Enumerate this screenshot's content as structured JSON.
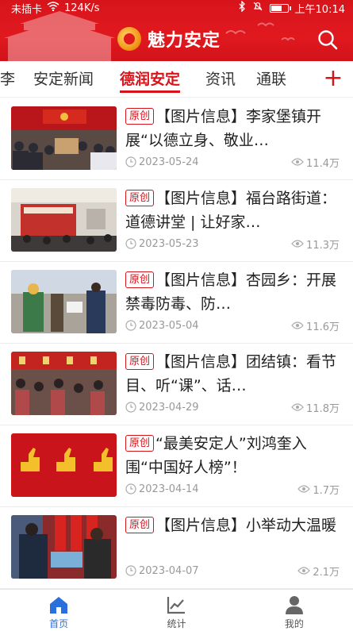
{
  "status_bar": {
    "left_text": "未插卡",
    "speed": "124K/s",
    "time": "上午10:14"
  },
  "header": {
    "title": "魅力安定"
  },
  "tabs": [
    {
      "label": "李",
      "active": false
    },
    {
      "label": "安定新闻",
      "active": false
    },
    {
      "label": "德润安定",
      "active": true
    },
    {
      "label": "资讯",
      "active": false
    },
    {
      "label": "通联",
      "active": false
    }
  ],
  "add_label": "+",
  "articles": [
    {
      "badge": "原创",
      "title": "【图片信息】李家堡镇开展“以德立身、敬业…",
      "date": "2023-05-24",
      "views": "11.4万"
    },
    {
      "badge": "原创",
      "title": "【图片信息】福台路街道：道德讲堂 | 让好家…",
      "date": "2023-05-23",
      "views": "11.3万"
    },
    {
      "badge": "原创",
      "title": "【图片信息】杏园乡：开展禁毒防毒、防…",
      "date": "2023-05-04",
      "views": "11.6万"
    },
    {
      "badge": "原创",
      "title": "【图片信息】团结镇：看节目、听“课”、话…",
      "date": "2023-04-29",
      "views": "11.8万"
    },
    {
      "badge": "原创",
      "title": "“最美安定人”刘鸿奎入围“中国好人榜”！",
      "date": "2023-04-14",
      "views": "1.7万"
    },
    {
      "badge": "原创",
      "title": "【图片信息】小举动大温暖",
      "date": "2023-04-07",
      "views": "2.1万"
    }
  ],
  "bottom_nav": [
    {
      "label": "首页",
      "icon": "home-icon",
      "active": true
    },
    {
      "label": "统计",
      "icon": "chart-icon",
      "active": false
    },
    {
      "label": "我的",
      "icon": "person-icon",
      "active": false
    }
  ],
  "colors": {
    "brand": "#d8141b",
    "nav_active": "#2a6fdb"
  }
}
